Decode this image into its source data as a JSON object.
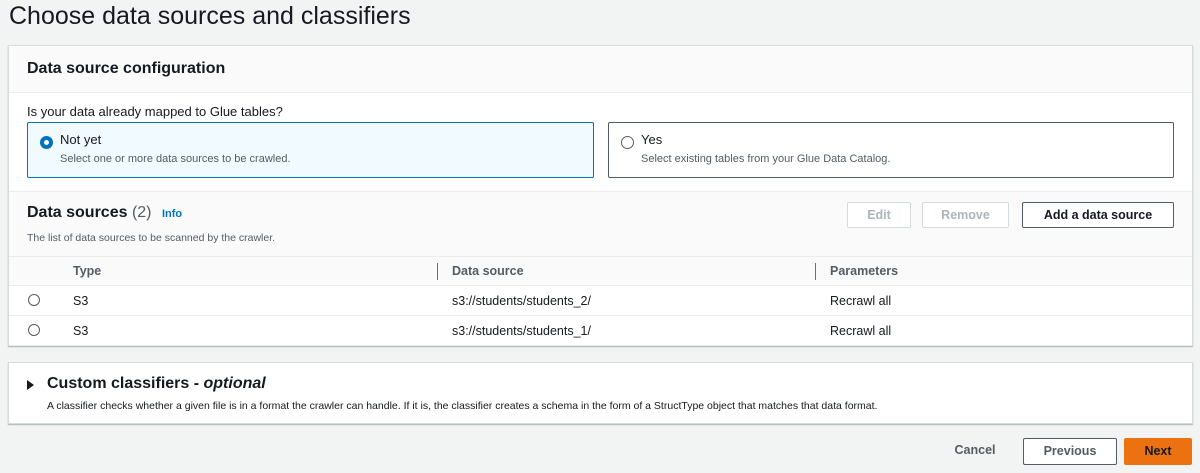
{
  "page": {
    "title": "Choose data sources and classifiers"
  },
  "config": {
    "header": "Data source configuration",
    "question": "Is your data already mapped to Glue tables?",
    "options": [
      {
        "label": "Not yet",
        "description": "Select one or more data sources to be crawled.",
        "selected": true
      },
      {
        "label": "Yes",
        "description": "Select existing tables from your Glue Data Catalog.",
        "selected": false
      }
    ]
  },
  "data_sources": {
    "title": "Data sources",
    "count": "(2)",
    "info_link": "Info",
    "description": "The list of data sources to be scanned by the crawler.",
    "buttons": {
      "edit": "Edit",
      "remove": "Remove",
      "add": "Add a data source"
    },
    "columns": [
      "Type",
      "Data source",
      "Parameters"
    ],
    "rows": [
      {
        "type": "S3",
        "source": "s3://students/students_2/",
        "params": "Recrawl all"
      },
      {
        "type": "S3",
        "source": "s3://students/students_1/",
        "params": "Recrawl all"
      }
    ]
  },
  "classifiers": {
    "title": "Custom classifiers - ",
    "optional": "optional",
    "description": "A classifier checks whether a given file is in a format the crawler can handle. If it is, the classifier creates a schema in the form of a StructType object that matches that data format."
  },
  "footer": {
    "cancel": "Cancel",
    "previous": "Previous",
    "next": "Next"
  },
  "colors": {
    "primary": "#ec7211",
    "link": "#0073bb",
    "selected_bg": "#f1faff"
  }
}
